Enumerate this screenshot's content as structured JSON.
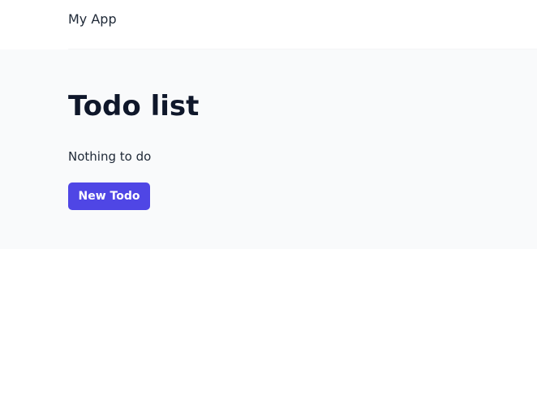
{
  "header": {
    "app_name": "My App"
  },
  "main": {
    "title": "Todo list",
    "empty_state": "Nothing to do",
    "new_todo_label": "New Todo"
  },
  "colors": {
    "primary_button": "#4f46e5",
    "content_background": "#f9fafb",
    "text": "#111827"
  }
}
